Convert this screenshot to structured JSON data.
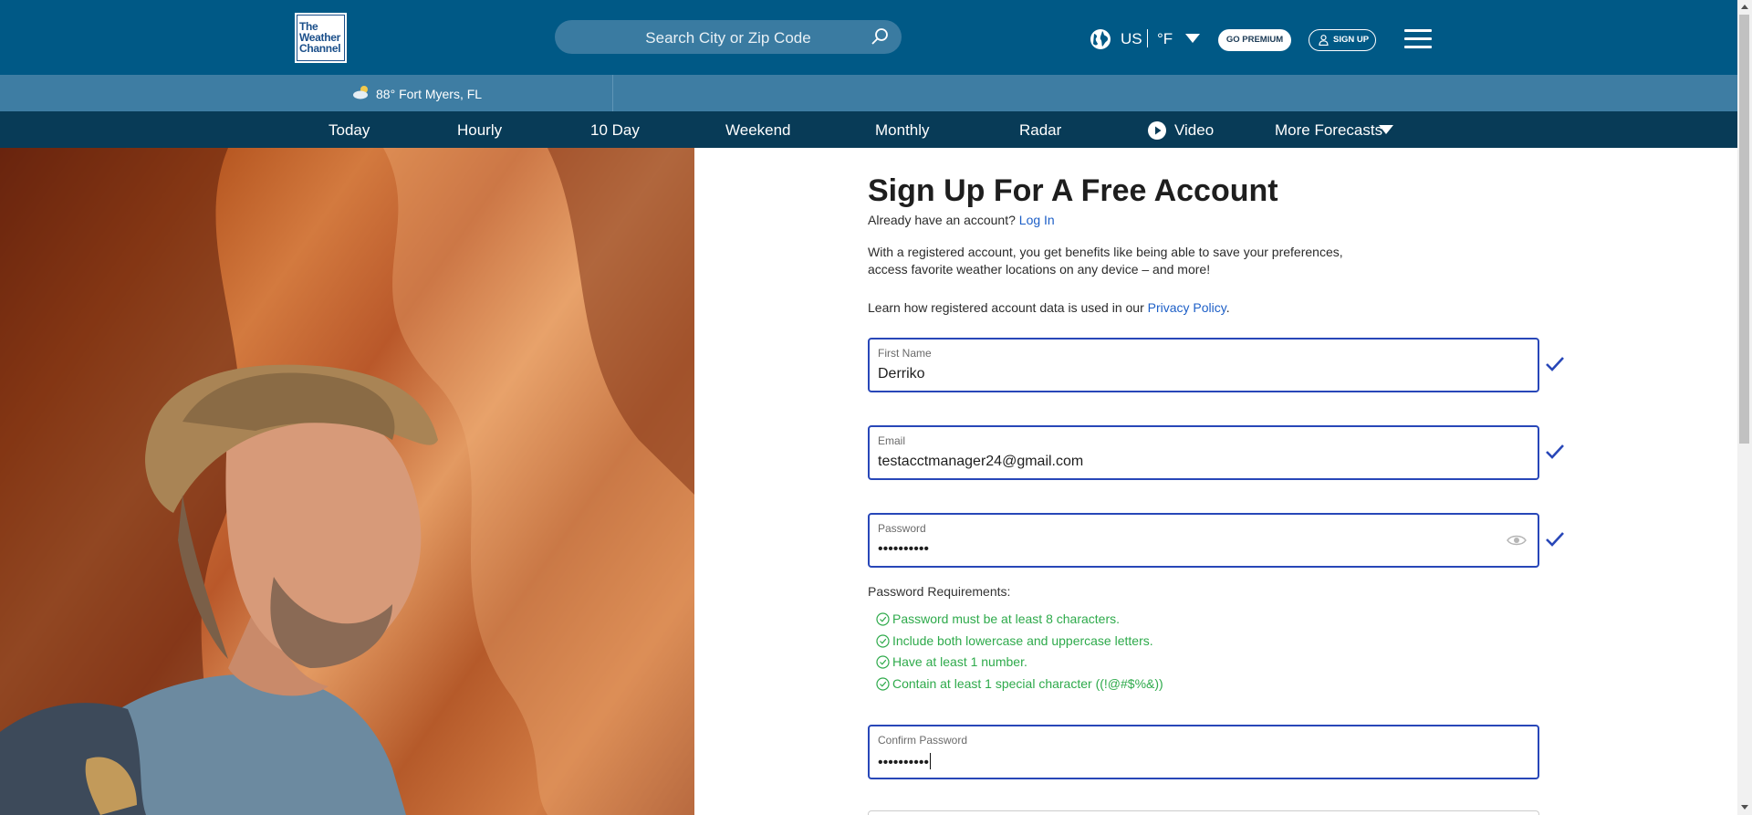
{
  "header": {
    "logo_lines": [
      "The",
      "Weather",
      "Channel"
    ],
    "search_placeholder": "Search City or Zip Code",
    "region": "US",
    "unit": "°F",
    "premium_label": "GO PREMIUM",
    "signup_label": "SIGN UP"
  },
  "location": {
    "temp": "88°",
    "city": "Fort Myers, FL"
  },
  "nav": {
    "items": [
      "Today",
      "Hourly",
      "10 Day",
      "Weekend",
      "Monthly",
      "Radar",
      "Video",
      "More Forecasts"
    ]
  },
  "form": {
    "title": "Sign Up For A Free Account",
    "have_account": "Already have an account?",
    "login_link": "Log In",
    "benefits_line1": "With a registered account, you get benefits like being able to save your preferences,",
    "benefits_line2": "access favorite weather locations on any device – and more!",
    "privacy_prefix": "Learn how registered account data is used in our",
    "privacy_link": "Privacy Policy",
    "privacy_suffix": ".",
    "fields": [
      {
        "label": "First Name",
        "value": "Derriko"
      },
      {
        "label": "Email",
        "value": "testacctmanager24@gmail.com"
      },
      {
        "label": "Password",
        "value": "••••••••••"
      },
      {
        "label": "Confirm Password",
        "value": "••••••••••"
      }
    ],
    "requirements_title": "Password Requirements:",
    "requirements": [
      "Password must be at least 8 characters.",
      "Include both lowercase and uppercase letters.",
      "Have at least 1 number.",
      "Contain at least 1 special character ((!@#$%&))"
    ]
  },
  "colors": {
    "header_bg": "#005986",
    "location_bg": "#3e7da3",
    "nav_bg": "#083b57",
    "field_border": "#2847b8",
    "valid_green": "#2eaa4b",
    "link_blue": "#1d5fc7"
  }
}
